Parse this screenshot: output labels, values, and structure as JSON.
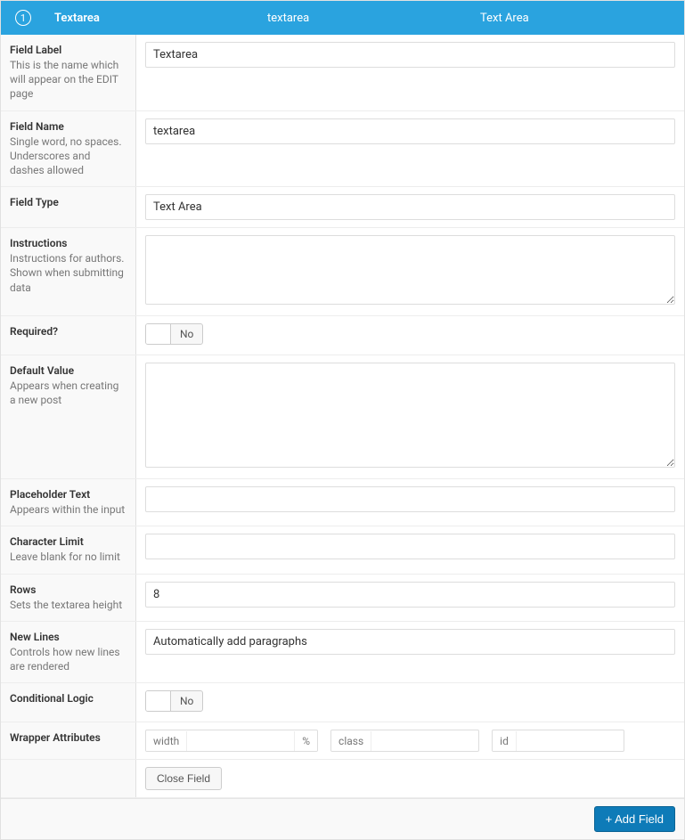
{
  "header": {
    "order": "1",
    "label": "Textarea",
    "name": "textarea",
    "type": "Text Area"
  },
  "rows": {
    "field_label": {
      "label": "Field Label",
      "desc": "This is the name which will appear on the EDIT page",
      "value": "Textarea"
    },
    "field_name": {
      "label": "Field Name",
      "desc": "Single word, no spaces. Underscores and dashes allowed",
      "value": "textarea"
    },
    "field_type": {
      "label": "Field Type",
      "desc": "",
      "value": "Text Area"
    },
    "instructions": {
      "label": "Instructions",
      "desc": "Instructions for authors. Shown when submitting data",
      "value": ""
    },
    "required": {
      "label": "Required?",
      "desc": "",
      "toggle": "No"
    },
    "default_value": {
      "label": "Default Value",
      "desc": "Appears when creating a new post",
      "value": ""
    },
    "placeholder_text": {
      "label": "Placeholder Text",
      "desc": "Appears within the input",
      "value": ""
    },
    "character_limit": {
      "label": "Character Limit",
      "desc": "Leave blank for no limit",
      "value": ""
    },
    "rows_setting": {
      "label": "Rows",
      "desc": "Sets the textarea height",
      "value": "8"
    },
    "new_lines": {
      "label": "New Lines",
      "desc": "Controls how new lines are rendered",
      "value": "Automatically add paragraphs"
    },
    "conditional_logic": {
      "label": "Conditional Logic",
      "desc": "",
      "toggle": "No"
    },
    "wrapper": {
      "label": "Wrapper Attributes",
      "width_prefix": "width",
      "width_value": "",
      "width_suffix": "%",
      "class_prefix": "class",
      "class_value": "",
      "id_prefix": "id",
      "id_value": ""
    }
  },
  "close_field": "Close Field",
  "add_field": "+ Add Field"
}
